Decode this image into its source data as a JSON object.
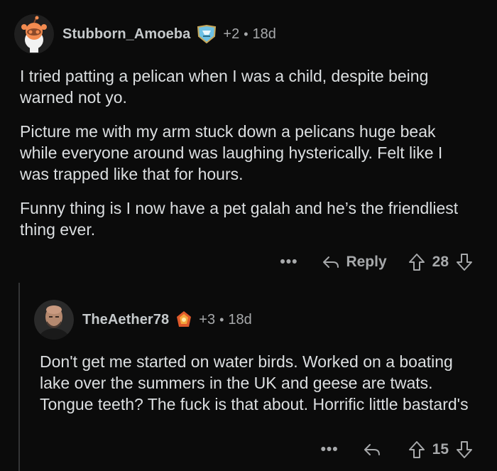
{
  "comments": [
    {
      "username": "Stubborn_Amoeba",
      "score_delta": "+2",
      "age": "18d",
      "paragraphs": [
        "I tried patting a pelican when I was a child, despite being warned not yo.",
        "Picture me with my arm stuck down a pelicans huge beak while everyone around was laughing hysterically. Felt like I was trapped like that for hours.",
        "Funny thing is I now have a pet galah and he’s the friendliest thing ever."
      ],
      "actions": {
        "more": "•••",
        "reply_label": "Reply",
        "votes": "28"
      }
    },
    {
      "username": "TheAether78",
      "score_delta": "+3",
      "age": "18d",
      "paragraphs": [
        "Don't get me started on water birds. Worked on a boating lake over the summers in the UK and geese are twats. Tongue teeth? The fuck is that about. Horrific little bastard's"
      ],
      "actions": {
        "more": "•••",
        "votes": "15"
      }
    }
  ],
  "separator": "•"
}
